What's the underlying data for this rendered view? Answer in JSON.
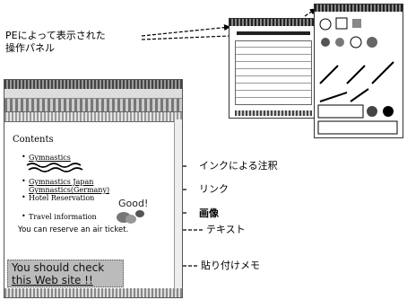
{
  "callouts": {
    "panel_line1": "PEによって表示された",
    "panel_line2": "操作パネル",
    "ink_note": "インクによる注釈",
    "link": "リンク",
    "image": "画像",
    "text": "テキスト",
    "memo": "貼り付けメモ"
  },
  "page": {
    "heading": "Contents",
    "links": [
      "Gymnastics",
      "Gymnastics Japan",
      "Gymnastics(Germany)"
    ],
    "hotel": "Hotel Reservation",
    "travel": "Travel information",
    "text_line": "You can reserve an air ticket.",
    "image_text": "Good!"
  },
  "memo": {
    "line1": "You should check",
    "line2": "this Web site !!"
  }
}
